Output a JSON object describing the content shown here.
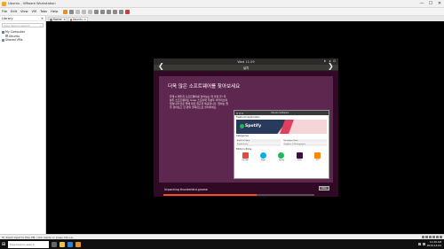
{
  "window": {
    "title": "Ubuntu - VMware Workstation",
    "min": "—",
    "max": "☐",
    "close": "✕"
  },
  "menu": [
    "File",
    "Edit",
    "View",
    "VM",
    "Tabs",
    "Help"
  ],
  "library": {
    "title": "Library",
    "close": "✕",
    "search_placeholder": "Type here to search",
    "tree": [
      {
        "label": "My Computer",
        "level": 0
      },
      {
        "label": "Ubuntu",
        "level": 1
      },
      {
        "label": "Shared VMs",
        "level": 0
      }
    ]
  },
  "tabs": [
    {
      "label": "Home",
      "active": false
    },
    {
      "label": "Ubuntu",
      "active": true
    }
  ],
  "installer": {
    "clock": "Wed 11:29",
    "window_title": "설치",
    "slide_heading": "더욱 많은 소프트웨어를 찾아보세요",
    "slide_description": "플래시 패키지 소프트웨어를 찾아보는 데 걱정 끝! 우분투 소프트웨어는 Snap 스토어와 우분투 아카이브의 엄청나게 많은 앱에 대한 접근을 제공합니다. 원하는 앱을 찾아보고 한 번의 클릭만으로 설치하세요.",
    "store": {
      "bar_title": "Ubuntu Software",
      "featured_label": "Featured Application",
      "banner_app": "Spotify",
      "categories_label": "Categories",
      "categories": [
        "Audio & Video",
        "Developer Tools",
        "Productivity",
        "Graphics & Photography"
      ],
      "editors_label": "Editor's Picks",
      "apps": [
        {
          "name": "Inkscape",
          "color": "#e04a3a"
        },
        {
          "name": "Skype",
          "color": "#00aff0"
        },
        {
          "name": "Spotify",
          "color": "#1db954"
        },
        {
          "name": "Slack",
          "color": "#3f0e40"
        },
        {
          "name": "VLC",
          "color": "#ff8800"
        }
      ]
    },
    "prev_arrow": "❮",
    "next_arrow": "❯",
    "progress_text": "Unpacking thunderbird-gnome",
    "skip_label": "Skip",
    "progress_fraction": 0.62,
    "accent": "#e95420"
  },
  "statusbar": {
    "text": "To direct input to this VM, click inside or press Ctrl+G."
  },
  "taskbar": {
    "search_placeholder": "Type here to search",
    "time": "11:29 AM",
    "date": "2019-12-04"
  }
}
